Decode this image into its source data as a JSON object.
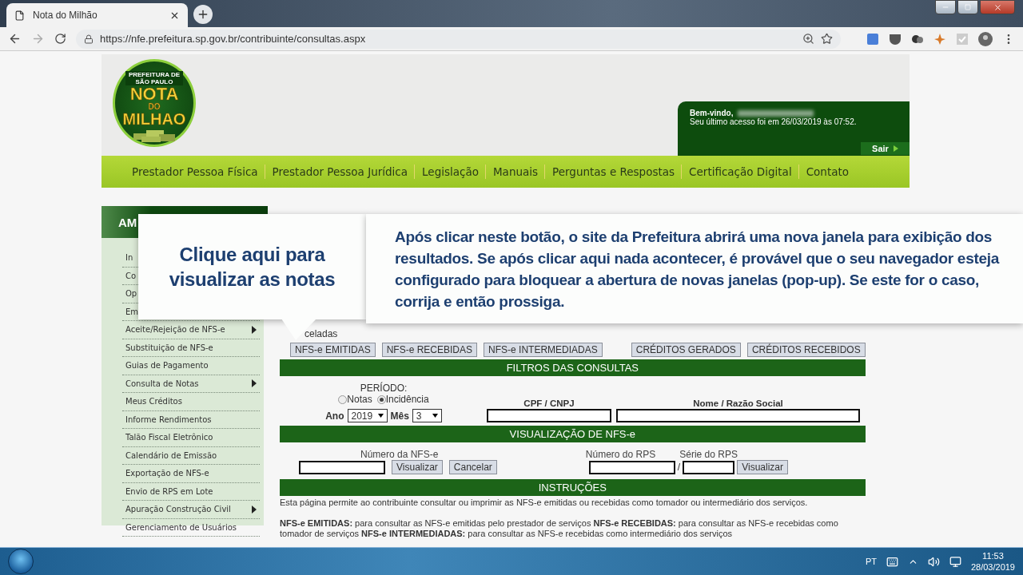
{
  "browser": {
    "tab_title": "Nota do Milhão",
    "url": "https://nfe.prefeitura.sp.gov.br/contribuinte/consultas.aspx"
  },
  "header": {
    "logo": {
      "top": "PREFEITURA DE SÃO PAULO",
      "line1": "NOTA",
      "line2": "DO",
      "line3": "MILHAO"
    },
    "welcome": {
      "greeting": "Bem-vindo,",
      "last_access": "Seu último acesso foi em 26/03/2019 às 07:52.",
      "logout": "Sair"
    }
  },
  "nav": [
    "Prestador Pessoa Física",
    "Prestador Pessoa Jurídica",
    "Legislação",
    "Manuais",
    "Perguntas e Respostas",
    "Certificação Digital",
    "Contato"
  ],
  "sidebar": {
    "title": "AM",
    "items": [
      {
        "label": "In",
        "submenu": false
      },
      {
        "label": "Co",
        "submenu": false
      },
      {
        "label": "Op",
        "submenu": false
      },
      {
        "label": "Em",
        "submenu": false
      },
      {
        "label": "Aceite/Rejeição de NFS-e",
        "submenu": true
      },
      {
        "label": "Substituição de NFS-e",
        "submenu": false
      },
      {
        "label": "Guias de Pagamento",
        "submenu": false
      },
      {
        "label": "Consulta de Notas",
        "submenu": true
      },
      {
        "label": "Meus Créditos",
        "submenu": false
      },
      {
        "label": "Informe Rendimentos",
        "submenu": false
      },
      {
        "label": "Talão Fiscal Eletrônico",
        "submenu": false
      },
      {
        "label": "Calendário de Emissão",
        "submenu": false
      },
      {
        "label": "Exportação de NFS-e",
        "submenu": false
      },
      {
        "label": "Envio de RPS em Lote",
        "submenu": false
      },
      {
        "label": "Apuração Construção Civil",
        "submenu": true
      },
      {
        "label": "Gerenciamento de Usuários",
        "submenu": false
      }
    ]
  },
  "main": {
    "partial_option": "celadas",
    "query_buttons": [
      "NFS-e EMITIDAS",
      "NFS-e RECEBIDAS",
      "NFS-e INTERMEDIADAS"
    ],
    "credit_buttons": [
      "CRÉDITOS GERADOS",
      "CRÉDITOS RECEBIDOS"
    ],
    "filters": {
      "title": "FILTROS DAS CONSULTAS",
      "period_label": "PERÍODO:",
      "period_options": [
        {
          "label": "Notas",
          "selected": false
        },
        {
          "label": "Incidência",
          "selected": true
        }
      ],
      "year_label": "Ano",
      "year": "2019",
      "month_label": "Mês",
      "month": "3",
      "cpf_label": "CPF / CNPJ",
      "name_label": "Nome / Razão Social"
    },
    "view": {
      "title": "VISUALIZAÇÃO DE NFS-e",
      "nfse_label": "Número da NFS-e",
      "view_button": "Visualizar",
      "cancel_button": "Cancelar",
      "rps_label": "Número do RPS",
      "series_label": "Série do RPS",
      "separator": "/",
      "rps_button": "Visualizar"
    },
    "instructions": {
      "title": "INSTRUÇÕES",
      "intro": "Esta página permite ao contribuinte consultar ou imprimir as NFS-e emitidas ou recebidas como tomador ou intermediário dos serviços.",
      "details": "**NFS-e EMITIDAS:** para consultar as NFS-e emitidas pelo prestador de serviços **NFS-e RECEBIDAS:** para consultar as NFS-e recebidas como tomador de serviços **NFS-e INTERMEDIADAS:** para consultar as NFS-e recebidas como intermediário dos serviços"
    }
  },
  "callouts": [
    {
      "text": "Clique aqui para visualizar as notas"
    },
    {
      "text": "Após clicar neste botão, o site da Prefeitura abrirá uma nova janela para exibição dos resultados. Se após clicar aqui nada acontecer, é provável que o seu navegador esteja configurado para bloquear a abertura de novas janelas (pop-up). Se este for o caso, corrija e então prossiga."
    }
  ],
  "taskbar": {
    "language": "PT",
    "time": "11:53",
    "date": "28/03/2019"
  }
}
